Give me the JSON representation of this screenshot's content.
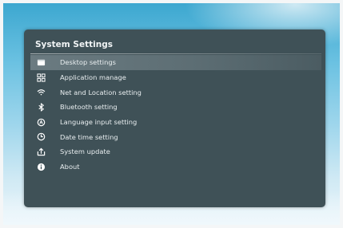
{
  "settings_panel": {
    "title": "System Settings",
    "items": [
      {
        "label": "Desktop settings",
        "icon": "desktop-icon",
        "selected": true
      },
      {
        "label": "Application manage",
        "icon": "apps-grid-icon",
        "selected": false
      },
      {
        "label": "Net and Location setting",
        "icon": "wifi-icon",
        "selected": false
      },
      {
        "label": "Bluetooth setting",
        "icon": "bluetooth-icon",
        "selected": false
      },
      {
        "label": "Language input setting",
        "icon": "language-icon",
        "selected": false
      },
      {
        "label": "Date time setting",
        "icon": "clock-icon",
        "selected": false
      },
      {
        "label": "System update",
        "icon": "update-icon",
        "selected": false
      },
      {
        "label": "About",
        "icon": "info-icon",
        "selected": false
      }
    ]
  },
  "colors": {
    "panel_background": "#3f5157",
    "selection_highlight": "#6b7b81",
    "text": "#e9eef0"
  }
}
